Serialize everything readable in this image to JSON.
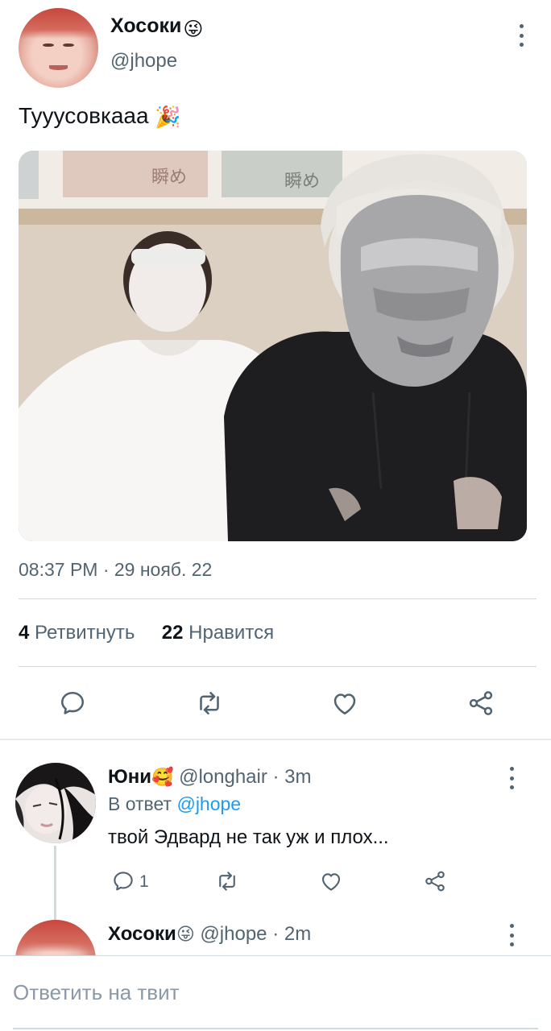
{
  "tweet": {
    "author_name": "Хосоки",
    "author_emoji": "😜",
    "author_handle": "@jhope",
    "text": "Тууусовкааа",
    "text_emoji": "🎉",
    "timestamp": "08:37 PM · 29 нояб. 22",
    "retweets_count": "4",
    "retweets_label": "Ретвитнуть",
    "likes_count": "22",
    "likes_label": "Нравится"
  },
  "replies": [
    {
      "author_name": "Юни",
      "author_emoji": "🥰",
      "author_handle": "@longhair",
      "time": "· 3m",
      "reply_to_label": "В ответ",
      "reply_to_handle": "@jhope",
      "text": "твой Эдвард не так уж и плох...",
      "reply_count": "1"
    },
    {
      "author_name": "Хосоки",
      "author_emoji": "😜",
      "author_handle": "@jhope",
      "time": "· 2m"
    }
  ],
  "compose": {
    "placeholder": "Ответить на твит"
  },
  "icons": {
    "reply": "reply-icon",
    "retweet": "retweet-icon",
    "like": "heart-icon",
    "share": "share-icon",
    "more": "more-icon"
  },
  "colors": {
    "link": "#1d9bf0",
    "secondary_text": "#536471",
    "divider": "#cfd9de"
  }
}
